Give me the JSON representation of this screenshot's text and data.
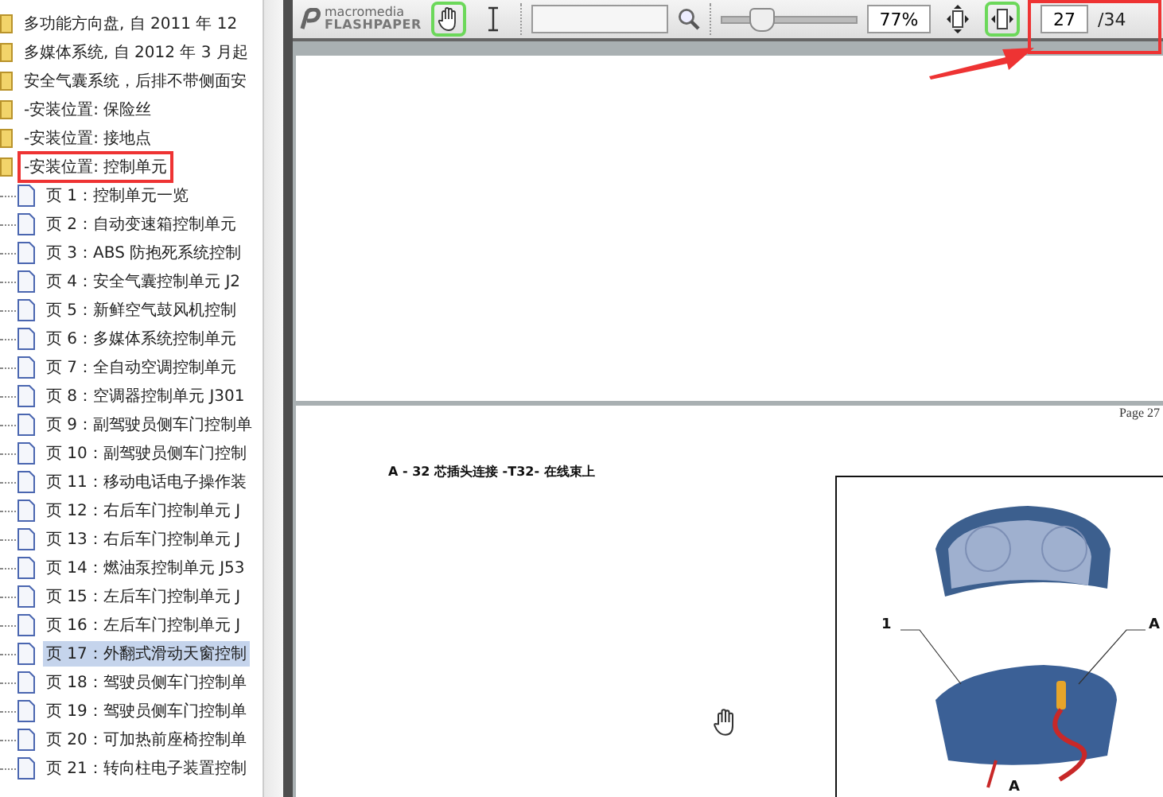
{
  "sidebar": {
    "items": [
      {
        "label": "多功能方向盘, 自 2011 年 12",
        "marked": false
      },
      {
        "label": "多媒体系统, 自 2012 年 3 月起",
        "marked": false
      },
      {
        "label": "安全气囊系统，后排不带侧面安",
        "marked": false
      },
      {
        "label": "-安装位置: 保险丝",
        "marked": false
      },
      {
        "label": "-安装位置: 接地点",
        "marked": false
      },
      {
        "label": "-安装位置: 控制单元",
        "marked": true,
        "children": [
          {
            "label": "页 1：控制单元一览",
            "selected": false
          },
          {
            "label": "页 2：自动变速箱控制单元",
            "selected": false
          },
          {
            "label": "页 3：ABS 防抱死系统控制",
            "selected": false
          },
          {
            "label": "页 4：安全气囊控制单元 J2",
            "selected": false
          },
          {
            "label": "页 5：新鲜空气鼓风机控制",
            "selected": false
          },
          {
            "label": "页 6：多媒体系统控制单元",
            "selected": false
          },
          {
            "label": "页 7：全自动空调控制单元",
            "selected": false
          },
          {
            "label": "页 8：空调器控制单元 J301",
            "selected": false
          },
          {
            "label": "页 9：副驾驶员侧车门控制单",
            "selected": false
          },
          {
            "label": "页 10：副驾驶员侧车门控制",
            "selected": false
          },
          {
            "label": "页 11：移动电话电子操作装",
            "selected": false
          },
          {
            "label": "页 12：右后车门控制单元 J",
            "selected": false
          },
          {
            "label": "页 13：右后车门控制单元 J",
            "selected": false
          },
          {
            "label": "页 14：燃油泵控制单元 J53",
            "selected": false
          },
          {
            "label": "页 15：左后车门控制单元 J",
            "selected": false
          },
          {
            "label": "页 16：左后车门控制单元 J",
            "selected": false
          },
          {
            "label": "页 17：外翻式滑动天窗控制",
            "selected": true
          },
          {
            "label": "页 18：驾驶员侧车门控制单",
            "selected": false
          },
          {
            "label": "页 19：驾驶员侧车门控制单",
            "selected": false
          },
          {
            "label": "页 20：可加热前座椅控制单",
            "selected": false
          },
          {
            "label": "页 21：转向柱电子装置控制",
            "selected": false
          }
        ]
      }
    ]
  },
  "toolbar": {
    "logo_small": "macromedia",
    "logo_large": "FLASHPAPER",
    "tools": [
      {
        "kind": "hand",
        "selected": true
      },
      {
        "kind": "text",
        "selected": false
      }
    ],
    "zoom": {
      "level": 0.3,
      "value": "77%"
    },
    "fit": [
      {
        "kind": "page",
        "selected": false
      },
      {
        "kind": "width",
        "selected": true
      }
    ],
    "page": {
      "value": "27",
      "total": "/34"
    },
    "page_annotated": true
  },
  "document": {
    "page_header": "Page 27",
    "caption": "A - 32 芯插头连接 -T32- 在线束上",
    "figure_labels": [
      "1",
      "A",
      "A"
    ]
  }
}
